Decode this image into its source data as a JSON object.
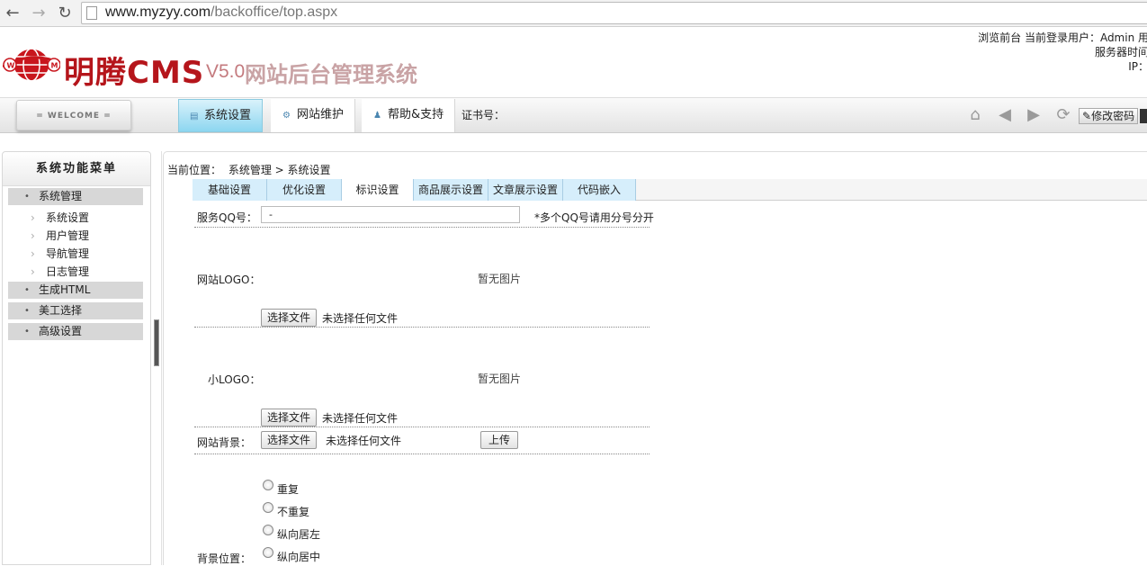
{
  "browser": {
    "url_host": "www.myzyy.com",
    "url_path": "/backoffice/top.aspx"
  },
  "header": {
    "logo_brand": "明腾CMS",
    "logo_version": "V5.0",
    "logo_system": "网站后台管理系统",
    "info_line1": "浏览前台 当前登录用户：Admin 用",
    "info_line2": "服务器时间",
    "info_line3": "IP："
  },
  "nav": {
    "welcome": "= WELCOME =",
    "tabs": [
      {
        "label": "系统设置",
        "icon": "monitor-icon"
      },
      {
        "label": "网站维护",
        "icon": "gear-icon"
      },
      {
        "label": "帮助&支持",
        "icon": "user-icon"
      }
    ],
    "cert": "证书号：",
    "change_password": "修改密码"
  },
  "sidebar": {
    "title": "系统功能菜单",
    "groups": [
      {
        "label": "系统管理",
        "items": [
          "系统设置",
          "用户管理",
          "导航管理",
          "日志管理"
        ]
      },
      {
        "label": "生成HTML"
      },
      {
        "label": "美工选择"
      },
      {
        "label": "高级设置"
      }
    ]
  },
  "main": {
    "breadcrumb_label": "当前位置：",
    "breadcrumb_path": "系统管理 > 系统设置",
    "subtabs": [
      "基础设置",
      "优化设置",
      "标识设置",
      "商品展示设置",
      "文章展示设置",
      "代码嵌入"
    ],
    "active_subtab": "标识设置",
    "form": {
      "qq_label": "服务QQ号：",
      "qq_value": "-",
      "qq_hint": "*多个QQ号请用分号分开",
      "logo_label": "网站LOGO：",
      "no_image": "暂无图片",
      "choose_file": "选择文件",
      "no_file": "未选择任何文件",
      "small_logo_label": "小LOGO：",
      "bg_label": "网站背景：",
      "upload": "上传",
      "bg_position_label": "背景位置：",
      "radio_options": [
        "重复",
        "不重复",
        "纵向居左",
        "纵向居中"
      ]
    }
  }
}
